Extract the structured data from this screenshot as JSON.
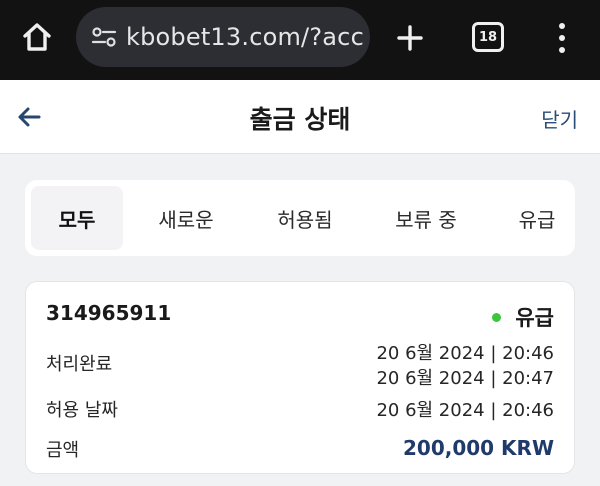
{
  "browser": {
    "url": "kbobet13.com/?acc",
    "tab_count": "18",
    "icons": [
      "home-icon",
      "site-settings-icon",
      "new-tab-plus-icon",
      "tab-switcher-icon",
      "overflow-menu-icon"
    ]
  },
  "header": {
    "title": "출금 상태",
    "close_label": "닫기",
    "back_icon": "back-arrow-icon"
  },
  "tabs": [
    {
      "label": "모두",
      "active": true
    },
    {
      "label": "새로운",
      "active": false
    },
    {
      "label": "허용됨",
      "active": false
    },
    {
      "label": "보류 중",
      "active": false
    },
    {
      "label": "유급",
      "active": false
    }
  ],
  "transaction": {
    "id": "314965911",
    "status": "유급",
    "status_color": "#3ec63b",
    "processed_label": "처리완료",
    "processed_values": [
      "20 6월 2024 | 20:46",
      "20 6월 2024 | 20:47"
    ],
    "approved_label": "허용 날짜",
    "approved_value": "20 6월 2024 | 20:46",
    "amount_label": "금액",
    "amount_value": "200,000 KRW",
    "amount_color": "#1f3a6b"
  }
}
